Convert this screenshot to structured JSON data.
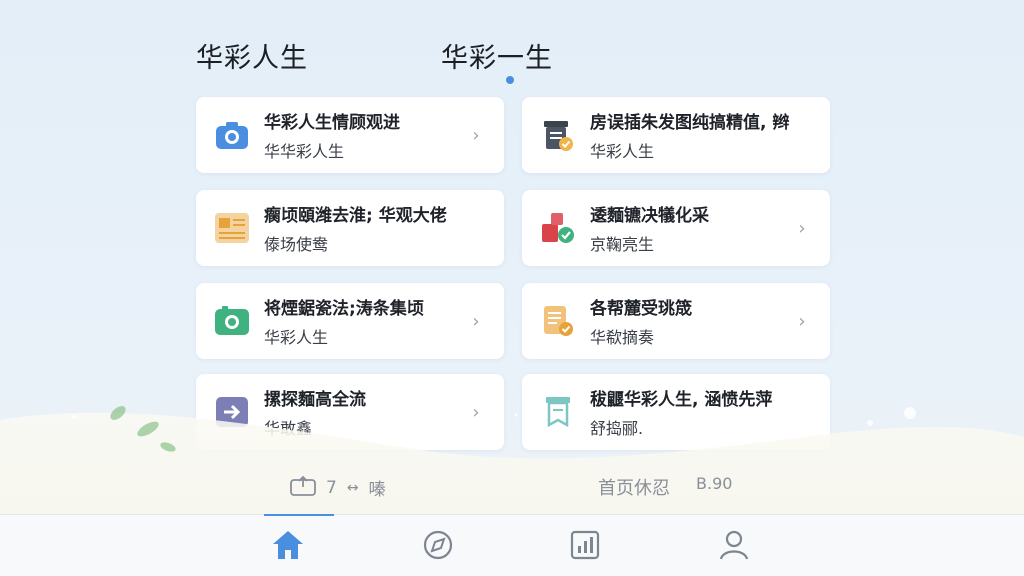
{
  "tabs": [
    {
      "label": "华彩人生"
    },
    {
      "label": "华彩一生"
    }
  ],
  "cards": [
    {
      "title": "华彩人生情顾观进",
      "subtitle": "华华彩人生",
      "icon": "camera-icon",
      "color": "#4a8ee0",
      "has_chevron": true
    },
    {
      "title": "房误插朱发图纯搞精值, 辫",
      "subtitle": "华彩人生",
      "icon": "archive-check-icon",
      "color": "#4b5563",
      "has_chevron": false
    },
    {
      "title": "瘸顷頤潍去淮; 华观大佬",
      "subtitle": "傣场使鸯",
      "icon": "newspaper-icon",
      "color": "#e8a23a",
      "has_chevron": false
    },
    {
      "title": "逶麵镳决犠化采",
      "subtitle": "京鞠亮生",
      "icon": "shapes-check-icon",
      "color": "#d9434a",
      "has_chevron": true
    },
    {
      "title": "将煙鋸瓷法;涛条集顷",
      "subtitle": "华彩人生",
      "icon": "photo-icon",
      "color": "#3fb27f",
      "has_chevron": true
    },
    {
      "title": "各帮麓受珧筬",
      "subtitle": "华欷摘奏",
      "icon": "document-check-icon",
      "color": "#e8a23a",
      "has_chevron": true
    },
    {
      "title": "摞探麵高全流",
      "subtitle": "华敢鑫",
      "icon": "arrow-right-icon",
      "color": "#6b6fa8",
      "has_chevron": true
    },
    {
      "title": "秡鼴华彩人生, 涵愤先萍",
      "subtitle": "舒捣郦.",
      "icon": "bookmark-icon",
      "color": "#3aa6a0",
      "has_chevron": false
    }
  ],
  "meta": {
    "left_count": "7",
    "left_arrows": "↔",
    "left_label": "嗪",
    "right_label": "首页休忍",
    "right_value": "B.90"
  },
  "nav": [
    {
      "icon": "home-icon",
      "active": true
    },
    {
      "icon": "discover-icon",
      "active": false
    },
    {
      "icon": "chart-icon",
      "active": false
    },
    {
      "icon": "user-icon",
      "active": false
    }
  ],
  "colors": {
    "accent": "#4a8ee0",
    "background": "#e6f0f8"
  }
}
